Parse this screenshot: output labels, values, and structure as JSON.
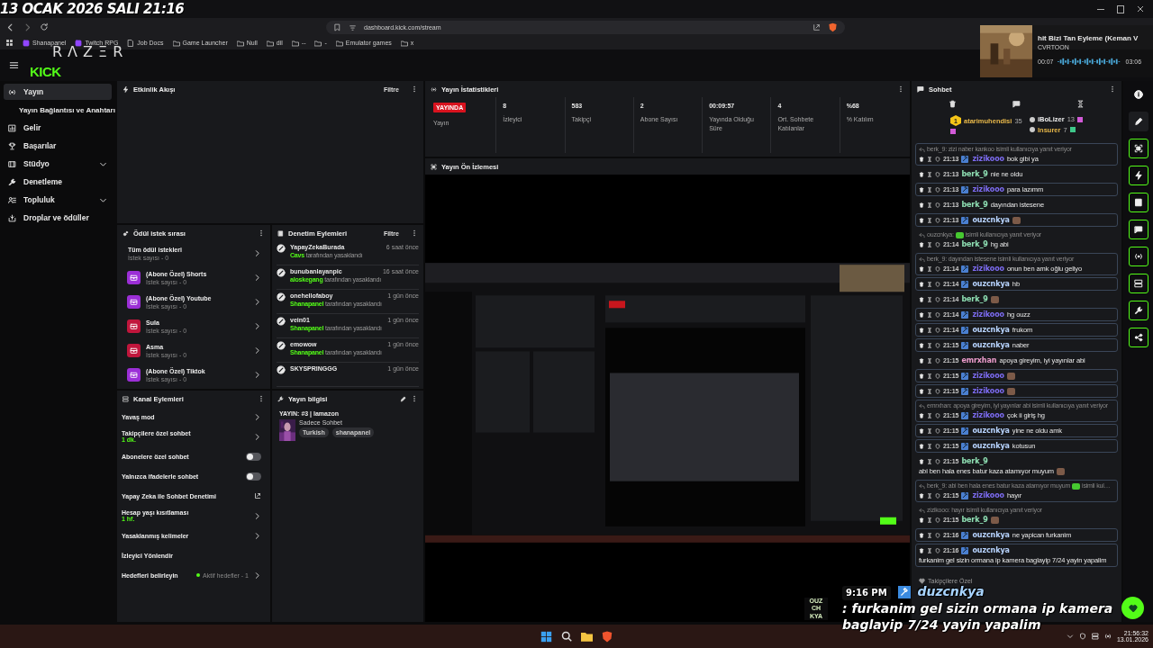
{
  "overlay_date": "13 OCAK 2026 SALI 21:16",
  "browser": {
    "url": "dashboard.kick.com/stream",
    "bookmarks": [
      {
        "label": "Shanapanel",
        "kind": "site"
      },
      {
        "label": "Twitch RPG",
        "kind": "site"
      },
      {
        "label": "Job Docs",
        "kind": "page"
      },
      {
        "label": "Game Launcher",
        "kind": "folder"
      },
      {
        "label": "Null",
        "kind": "folder"
      },
      {
        "label": "dil",
        "kind": "folder"
      },
      {
        "label": "--",
        "kind": "folder"
      },
      {
        "label": "-",
        "kind": "folder"
      },
      {
        "label": "Emulator games",
        "kind": "folder"
      },
      {
        "label": "x",
        "kind": "folder"
      }
    ]
  },
  "logos": {
    "razer": "RΛZΞR",
    "kick": "KICK"
  },
  "media_player": {
    "title": "hit Bizi Tan Eyleme (Keman V",
    "artist": "CVRTOON",
    "elapsed": "00:07",
    "duration": "03:06"
  },
  "sidebar": {
    "items": [
      {
        "label": "Yayın",
        "selected": true,
        "sub": false,
        "expandable": false
      },
      {
        "label": "Yayın Bağlantısı ve Anahtarı",
        "selected": false,
        "sub": true,
        "expandable": false
      },
      {
        "label": "Gelir",
        "selected": false,
        "sub": false,
        "expandable": false
      },
      {
        "label": "Başarılar",
        "selected": false,
        "sub": false,
        "expandable": false
      },
      {
        "label": "Stüdyo",
        "selected": false,
        "sub": false,
        "expandable": true
      },
      {
        "label": "Denetleme",
        "selected": false,
        "sub": false,
        "expandable": false
      },
      {
        "label": "Topluluk",
        "selected": false,
        "sub": false,
        "expandable": true
      },
      {
        "label": "Droplar ve ödüller",
        "selected": false,
        "sub": false,
        "expandable": false
      }
    ]
  },
  "activity_feed": {
    "title": "Etkinlik Akışı",
    "filter": "Filtre"
  },
  "reward_queue": {
    "title": "Ödül istek sırası",
    "items": [
      {
        "name": "Tüm ödül istekleri",
        "count": "İstek sayısı - 0"
      },
      {
        "name": "(Abone Özel) Shorts",
        "count": "İstek sayısı - 0",
        "color": "#9b2fd6"
      },
      {
        "name": "(Abone Özel) Youtube",
        "count": "İstek sayısı - 0",
        "color": "#9b2fd6"
      },
      {
        "name": "Sula",
        "count": "İstek sayısı - 0",
        "color": "#c0163c"
      },
      {
        "name": "Asma",
        "count": "İstek sayısı - 0",
        "color": "#c0163c"
      },
      {
        "name": "(Abone Özel) Tiktok",
        "count": "İstek sayısı - 0",
        "color": "#9b2fd6"
      }
    ]
  },
  "mod_actions": {
    "title": "Denetim Eylemleri",
    "filter": "Filtre",
    "items": [
      {
        "user": "YapayZekaBurada",
        "moderator": "Cavs",
        "action": "tarafından yasaklandı",
        "time": "6 saat önce"
      },
      {
        "user": "bunubanlayanpic",
        "moderator": "aloskegang",
        "action": "tarafından yasaklandı",
        "time": "16 saat önce"
      },
      {
        "user": "onehellofaboy",
        "moderator": "Shanapanel",
        "action": "tarafından yasaklandı",
        "time": "1 gün önce"
      },
      {
        "user": "vein01",
        "moderator": "Shanapanel",
        "action": "tarafından yasaklandı",
        "time": "1 gün önce"
      },
      {
        "user": "emowow",
        "moderator": "Shanapanel",
        "action": "tarafından yasaklandı",
        "time": "1 gün önce"
      },
      {
        "user": "SKYSPRINGGG",
        "time": "1 gün önce"
      }
    ]
  },
  "channel_actions": {
    "title": "Kanal Eylemleri",
    "items": [
      {
        "label": "Yavaş mod",
        "kind": "link"
      },
      {
        "label": "Takipçilere özel sohbet",
        "value": "1 dk.",
        "kind": "link"
      },
      {
        "label": "Abonelere özel sohbet",
        "kind": "toggle",
        "on": false
      },
      {
        "label": "Yalnızca ifadelerle sohbet",
        "kind": "toggle",
        "on": false
      },
      {
        "label": "Yapay Zeka ile Sohbet Denetimi",
        "kind": "external"
      },
      {
        "label": "Hesap yaşı kısıtlaması",
        "value": "1 hf.",
        "kind": "link"
      },
      {
        "label": "Yasaklanmış kelimeler",
        "kind": "link"
      },
      {
        "label": "İzleyici Yönlendir",
        "kind": "plain"
      },
      {
        "label": "Hedefleri belirleyin",
        "status": "Aktif hedefler - 1",
        "kind": "link"
      }
    ]
  },
  "stream_info": {
    "title": "Yayın bilgisi",
    "stream_title": "YAYIN: #3 | lamazon",
    "category": "Sadece Sohbet",
    "tags": [
      "Turkish",
      "shanapanel"
    ]
  },
  "stream_stats": {
    "title": "Yayın İstatistikleri",
    "items": [
      {
        "kind": "badge",
        "value": "YAYINDA",
        "label": "Yayın"
      },
      {
        "kind": "value",
        "value": "8",
        "label": "İzleyici"
      },
      {
        "kind": "value",
        "value": "583",
        "label": "Takipçi"
      },
      {
        "kind": "value",
        "value": "2",
        "label": "Abone Sayısı"
      },
      {
        "kind": "value",
        "value": "00:09:57",
        "label": "Yayında Olduğu Süre"
      },
      {
        "kind": "value",
        "value": "4",
        "label": "Ort. Sohbete Katılanlar"
      },
      {
        "kind": "value",
        "value": "%68",
        "label": "% Katılım"
      }
    ]
  },
  "stream_preview": {
    "title": "Yayın Ön İzlemesi",
    "kind": "picture"
  },
  "chat": {
    "title": "Sohbet",
    "leaderboard": [
      {
        "rank": "1",
        "name": "atarimuhendisi",
        "count": "35",
        "color": "#e8b84a"
      },
      {
        "name": "iBoLizer",
        "count": "13",
        "color": "#f0f0f0"
      },
      {
        "name": "Insurer",
        "count": "7",
        "color": "#e8b84a"
      }
    ],
    "messages": [
      {
        "reply": {
          "text": "berk_9: zizi naber kankoo isimli kullanıcıya yanıt veriyor"
        },
        "time": "21:13",
        "user": "zizikooo",
        "mod": true,
        "color": "#7d6cf2",
        "text": "bok gibi ya",
        "highlighted": true
      },
      {
        "time": "21:13",
        "user": "berk_9",
        "mod": false,
        "color": "#8fe0b4",
        "text": "nie ne oldu",
        "highlighted": false
      },
      {
        "time": "21:13",
        "user": "zizikooo",
        "mod": true,
        "color": "#7d6cf2",
        "text": "para lazımm",
        "highlighted": true
      },
      {
        "time": "21:13",
        "user": "berk_9",
        "mod": false,
        "color": "#8fe0b4",
        "text": "dayından istesene",
        "highlighted": false
      },
      {
        "time": "21:13",
        "user": "ouzcnkya",
        "mod": true,
        "color": "#b8d4ff",
        "emote": true,
        "highlighted": true
      },
      {
        "reply": {
          "text": "ouzcnkya:",
          "emote": true,
          "text_2": "isimli kullanıcıya yanıt veriyor"
        },
        "time": "21:14",
        "user": "berk_9",
        "mod": false,
        "color": "#8fe0b4",
        "text": "hg abi",
        "highlighted": false
      },
      {
        "reply": {
          "text": "berk_9: dayından istesene isimli kullanıcıya yanıt veriyor"
        },
        "time": "21:14",
        "user": "zizikooo",
        "mod": true,
        "color": "#7d6cf2",
        "text": "onun ben amk oğlu geliyo",
        "highlighted": true
      },
      {
        "time": "21:14",
        "user": "ouzcnkya",
        "mod": true,
        "color": "#b8d4ff",
        "text": "hb",
        "highlighted": true
      },
      {
        "time": "21:14",
        "user": "berk_9",
        "mod": false,
        "color": "#8fe0b4",
        "emote": true,
        "highlighted": false
      },
      {
        "time": "21:14",
        "user": "zizikooo",
        "mod": true,
        "color": "#7d6cf2",
        "text": "hg ouzz",
        "highlighted": true
      },
      {
        "time": "21:14",
        "user": "ouzcnkya",
        "mod": true,
        "color": "#b8d4ff",
        "text": "frukom",
        "highlighted": true
      },
      {
        "time": "21:15",
        "user": "ouzcnkya",
        "mod": true,
        "color": "#b8d4ff",
        "text": "naber",
        "highlighted": true
      },
      {
        "time": "21:15",
        "user": "emrxhan",
        "mod": false,
        "color": "#ec9ccc",
        "text": "apoya gireyim, iyi yayınlar abi",
        "highlighted": false
      },
      {
        "time": "21:15",
        "user": "zizikooo",
        "mod": true,
        "color": "#7d6cf2",
        "emote": true,
        "highlighted": true
      },
      {
        "time": "21:15",
        "user": "zizikooo",
        "mod": true,
        "color": "#7d6cf2",
        "emote": true,
        "highlighted": true
      },
      {
        "reply": {
          "text": "emrxhan: apoya gireyim, iyi yayınlar abi isimli kullanıcıya yanıt veriyor"
        },
        "time": "21:15",
        "user": "zizikooo",
        "mod": true,
        "color": "#7d6cf2",
        "text": "çok ii giriş hg",
        "highlighted": true
      },
      {
        "time": "21:15",
        "user": "ouzcnkya",
        "mod": true,
        "color": "#b8d4ff",
        "text": "yine ne oldu amk",
        "highlighted": true
      },
      {
        "time": "21:15",
        "user": "ouzcnkya",
        "mod": true,
        "color": "#b8d4ff",
        "text": "kotusun",
        "highlighted": true
      },
      {
        "time": "21:15",
        "user": "berk_9",
        "mod": false,
        "color": "#8fe0b4",
        "text": "abi ben hala enes batur kaza atamıyor muyum",
        "emote": true,
        "highlighted": false
      },
      {
        "reply": {
          "text": "berk_9: abi ben hala enes batur kaza atamıyor muyum",
          "emote": true,
          "text_2": "isimli kul…"
        },
        "time": "21:15",
        "user": "zizikooo",
        "mod": true,
        "color": "#7d6cf2",
        "text": "hayır",
        "highlighted": true
      },
      {
        "reply": {
          "text": "zizikooo: hayır isimli kullanıcıya yanıt veriyor"
        },
        "time": "21:15",
        "user": "berk_9",
        "mod": false,
        "color": "#8fe0b4",
        "emote": true,
        "highlighted": false
      },
      {
        "time": "21:16",
        "user": "ouzcnkya",
        "mod": true,
        "color": "#b8d4ff",
        "text": "ne yapican furkanim",
        "highlighted": true
      },
      {
        "time": "21:16",
        "user": "ouzcnkya",
        "mod": true,
        "color": "#b8d4ff",
        "text": "furkanim gel sizin ormana ip kamera baglayip 7/24 yayin yapalim",
        "highlighted": true
      }
    ],
    "footer": "Takipçilere Özel"
  },
  "chat_overlay": {
    "channel_logo": "OUZ CH KYA",
    "time": "9:16 PM",
    "user": "duzcnkya",
    "text": ": furkanim gel sizin ormana ip kamera baglayip 7/24 yayin yapalim"
  },
  "taskbar": {
    "time": "21:56:32",
    "date": "13.01.2026"
  }
}
